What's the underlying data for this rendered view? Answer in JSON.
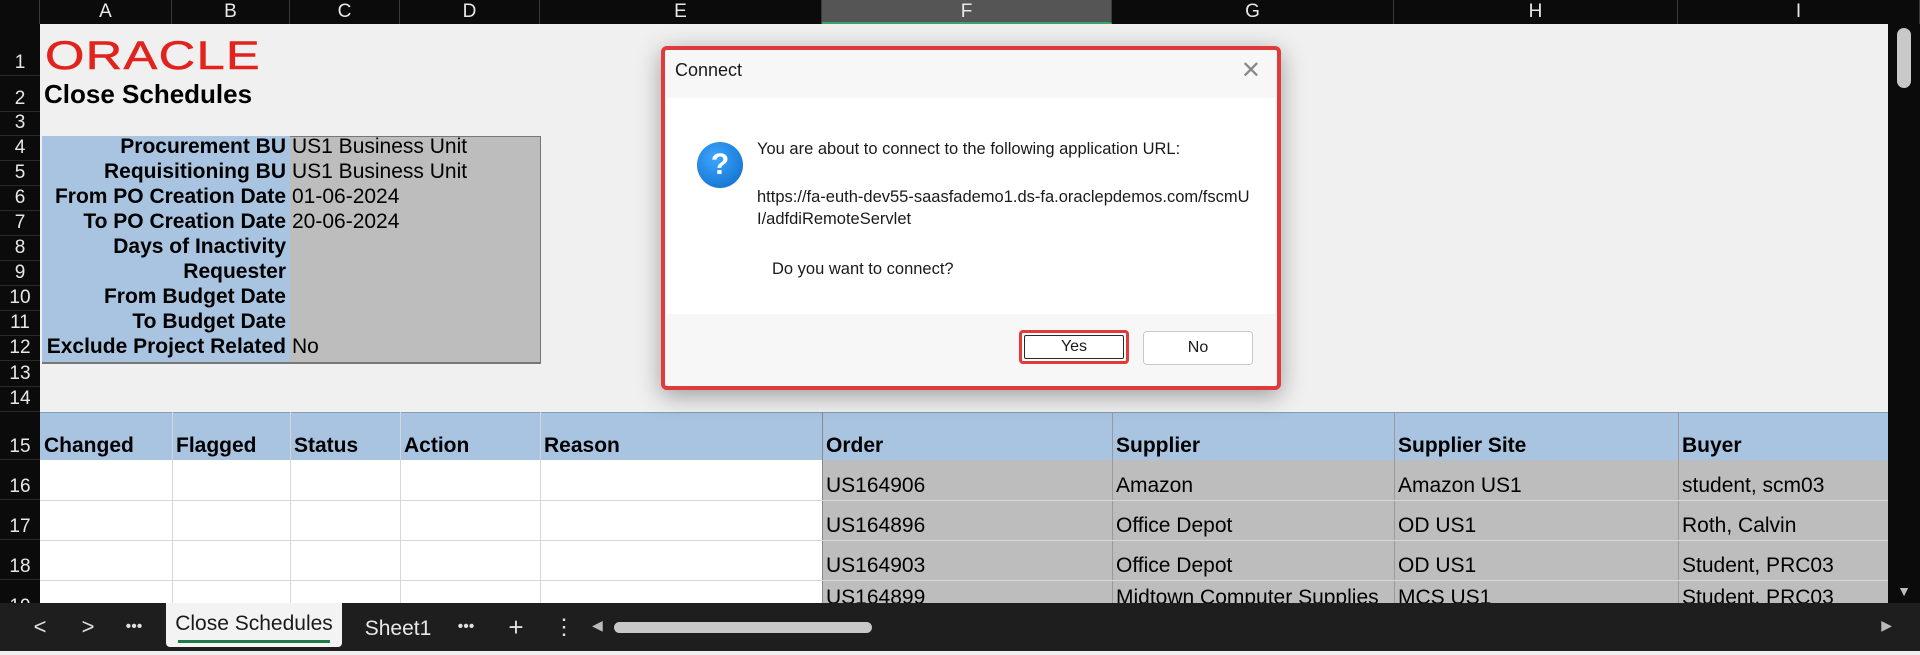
{
  "columns": [
    "A",
    "B",
    "C",
    "D",
    "E",
    "F",
    "G",
    "H",
    "I"
  ],
  "rows": [
    "1",
    "2",
    "3",
    "4",
    "5",
    "6",
    "7",
    "8",
    "9",
    "10",
    "11",
    "12",
    "13",
    "14",
    "15",
    "16",
    "17",
    "18",
    "19"
  ],
  "logo": {
    "text": "ORACLE",
    "color": "#e2221c"
  },
  "sheet_title": "Close Schedules",
  "params": [
    {
      "label": "Procurement BU",
      "value": "US1 Business Unit"
    },
    {
      "label": "Requisitioning BU",
      "value": "US1 Business Unit"
    },
    {
      "label": "From PO Creation Date",
      "value": "01-06-2024"
    },
    {
      "label": "To PO Creation Date",
      "value": "20-06-2024"
    },
    {
      "label": "Days of Inactivity",
      "value": ""
    },
    {
      "label": "Requester",
      "value": ""
    },
    {
      "label": "From Budget Date",
      "value": ""
    },
    {
      "label": "To Budget Date",
      "value": ""
    },
    {
      "label": "Exclude Project Related",
      "value": "No"
    }
  ],
  "table_headers": [
    "Changed",
    "Flagged",
    "Status",
    "Action",
    "Reason",
    "Order",
    "Supplier",
    "Supplier Site",
    "Buyer"
  ],
  "table_rows": [
    {
      "order": "US164906",
      "supplier": "Amazon",
      "site": "Amazon US1",
      "buyer": "student, scm03"
    },
    {
      "order": "US164896",
      "supplier": "Office Depot",
      "site": "OD US1",
      "buyer": "Roth, Calvin"
    },
    {
      "order": "US164903",
      "supplier": "Office Depot",
      "site": "OD US1",
      "buyer": "Student, PRC03"
    },
    {
      "order": "US164899",
      "supplier": "Midtown Computer Supplies",
      "site": "MCS US1",
      "buyer": "Student, PRC03"
    }
  ],
  "tabs": {
    "active": "Close Schedules",
    "other": "Sheet1",
    "more": "•••",
    "add": "+",
    "options": "⋮",
    "prev": "<",
    "next": ">"
  },
  "dialog": {
    "title": "Connect",
    "close": "✕",
    "icon": "?",
    "message": "You are about to connect to the following application URL:",
    "url": "https://fa-euth-dev55-saasfademo1.ds-fa.oraclepdemos.com/fscmUI/adfdiRemoteServlet",
    "question": "Do you want to connect?",
    "yes": "Yes",
    "no": "No"
  },
  "colors": {
    "header_band": "#a9c4e0",
    "gray_fill": "#bdbdbd",
    "highlight": "#e03a3a",
    "accent_green": "#1f7a4a"
  }
}
